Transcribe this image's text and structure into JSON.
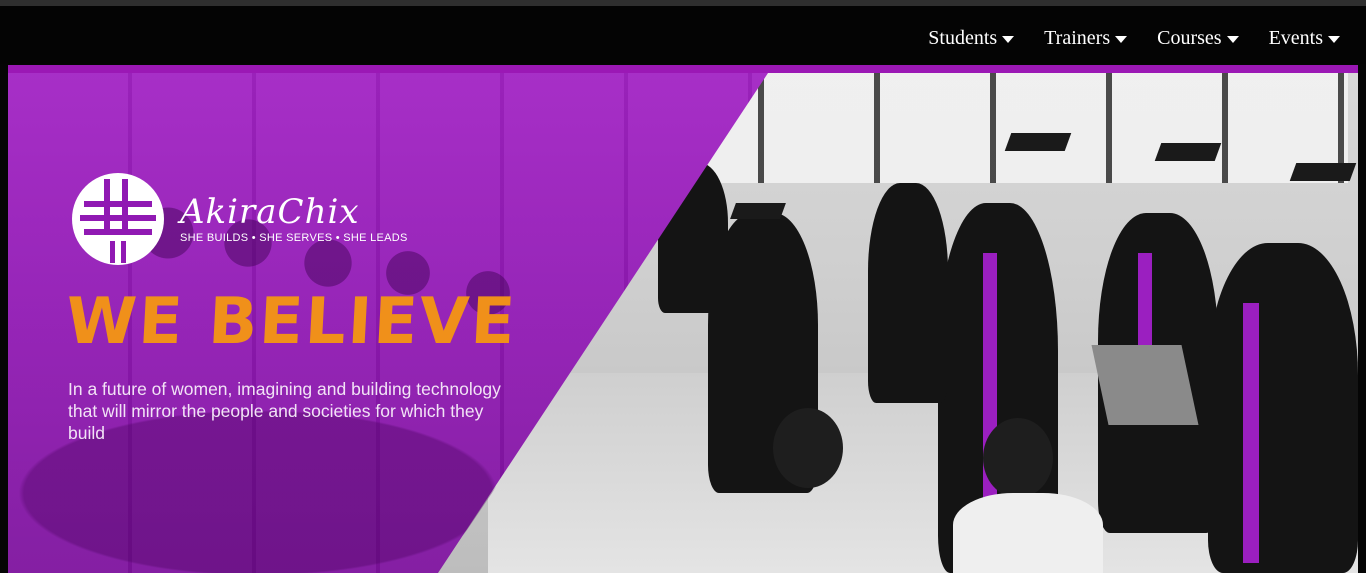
{
  "nav": {
    "items": [
      {
        "label": "Students"
      },
      {
        "label": "Trainers"
      },
      {
        "label": "Courses"
      },
      {
        "label": "Events"
      }
    ]
  },
  "hero": {
    "logo": {
      "name": "AkiraChix",
      "tagline": "SHE BUILDS • SHE SERVES • SHE LEADS"
    },
    "headline": "WE BELIEVE",
    "subtext": "In a future of women, imagining and building technology that will mirror the people and societies for which they build"
  },
  "colors": {
    "navbar_bg": "#040404",
    "overlay_purple": "#9019b3",
    "headline_orange": "#f0901a",
    "nav_text": "#ffffff"
  },
  "icons": {
    "dropdown": "caret-down-icon",
    "logo": "akirachix-logo-icon"
  }
}
